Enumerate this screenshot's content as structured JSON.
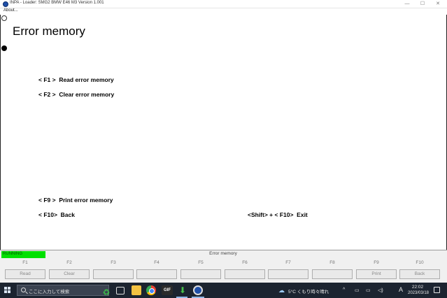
{
  "window": {
    "title": "INPA - Loader:  SMG2 BMW E46 M3 Version 1.001",
    "minimize_icon": "—",
    "maximize_icon": "☐",
    "close_icon": "✕"
  },
  "menu": {
    "about": "About..."
  },
  "main": {
    "title": "Error memory",
    "options": [
      {
        "key": "< F1 >",
        "label": "Read error memory"
      },
      {
        "key": "< F2 >",
        "label": "Clear error memory"
      },
      {
        "key": "< F9 >",
        "label": "Print error memory"
      },
      {
        "key": "< F10>",
        "label": "Back"
      }
    ],
    "exit_option": {
      "key": "<Shift> + < F10>",
      "label": "Exit"
    }
  },
  "status": {
    "running": "RUNNING",
    "screen_name": "Error memory"
  },
  "fkeys": [
    {
      "label": "F1",
      "button": "Read"
    },
    {
      "label": "F2",
      "button": "Clear"
    },
    {
      "label": "F3",
      "button": ""
    },
    {
      "label": "F4",
      "button": ""
    },
    {
      "label": "F5",
      "button": ""
    },
    {
      "label": "F6",
      "button": ""
    },
    {
      "label": "F7",
      "button": ""
    },
    {
      "label": "F8",
      "button": ""
    },
    {
      "label": "F9",
      "button": "Print"
    },
    {
      "label": "F10",
      "button": "Back"
    }
  ],
  "taskbar": {
    "search_placeholder": "ここに入力して検索",
    "gif_label": "GIF",
    "weather": "5°C  くもり時々晴れ",
    "ime": "A",
    "time": "22:02",
    "date": "2023/03/18",
    "tray_up": "^",
    "tray_network": "▭",
    "tray_volume": "◁)"
  },
  "colors": {
    "running_bg": "#00e000",
    "taskbar_bg": "#1c2430",
    "accent": "#1f4fa8"
  }
}
